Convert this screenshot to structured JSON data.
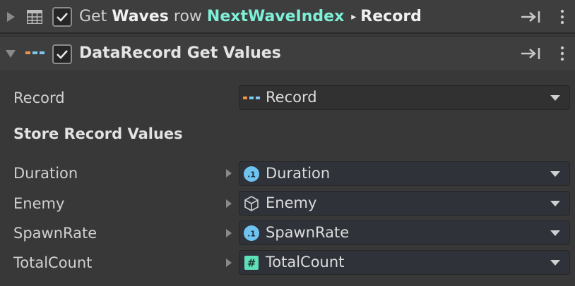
{
  "action1": {
    "prefix": "Get",
    "table_name": "Waves",
    "row_word": "row",
    "row_var": "NextWaveIndex",
    "arrow": "▸",
    "target": "Record",
    "checked": true
  },
  "action2": {
    "title": "DataRecord Get Values",
    "checked": true
  },
  "record_field": {
    "label": "Record",
    "value": "Record"
  },
  "section": {
    "title": "Store Record Values"
  },
  "fields": [
    {
      "label": "Duration",
      "value": "Duration",
      "icon": "float-icon"
    },
    {
      "label": "Enemy",
      "value": "Enemy",
      "icon": "cube-icon"
    },
    {
      "label": "SpawnRate",
      "value": "SpawnRate",
      "icon": "float-icon"
    },
    {
      "label": "TotalCount",
      "value": "TotalCount",
      "icon": "int-icon"
    }
  ],
  "colors": {
    "accent_teal": "#7ef0d8",
    "float_icon_blue": "#6fc3f0",
    "int_icon_green": "#5ee0b8",
    "record_orange": "#f0934a",
    "record_blue": "#7ec8f0"
  }
}
